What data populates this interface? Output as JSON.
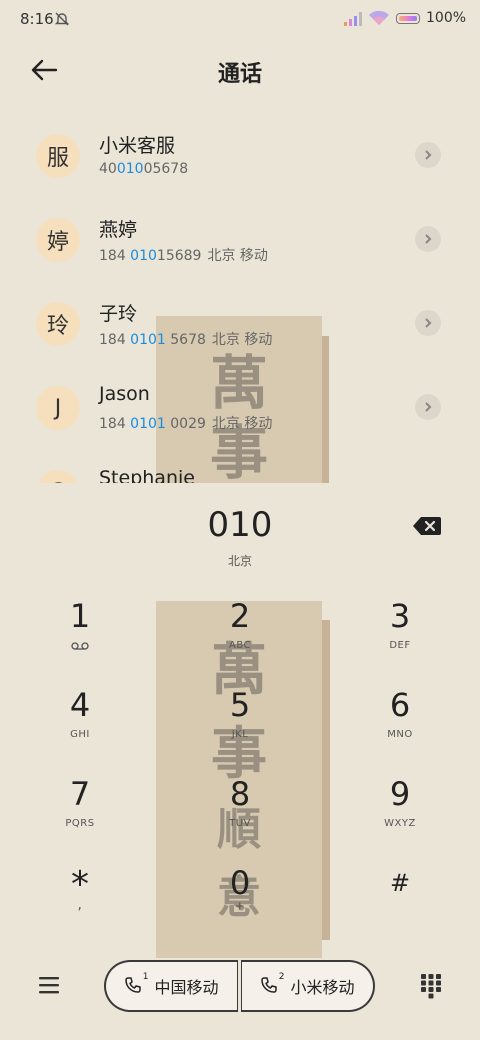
{
  "status": {
    "time": "8:16",
    "battery": "100%"
  },
  "header": {
    "title": "通话"
  },
  "contacts": [
    {
      "avatar": "服",
      "name": "小米客服",
      "num_pre": "40",
      "num_hl": "010",
      "num_post": "05678",
      "location": ""
    },
    {
      "avatar": "婷",
      "name": "燕婷",
      "num_pre": "184 ",
      "num_hl": "010",
      "num_post": "15689",
      "location": "北京 移动"
    },
    {
      "avatar": "玲",
      "name": "子玲",
      "num_pre": "184 ",
      "num_hl": "0101",
      "num_post": " 5678",
      "location": "北京 移动"
    },
    {
      "avatar": "J",
      "name": "Jason",
      "num_pre": "184 ",
      "num_hl": "0101",
      "num_post": " 0029",
      "location": "北京 移动"
    },
    {
      "avatar": "S",
      "name": "Stephanie",
      "num_pre": "",
      "num_hl": "",
      "num_post": "",
      "location": ""
    }
  ],
  "dial": {
    "number": "010",
    "location": "北京"
  },
  "keys": [
    {
      "digit": "1",
      "letters": ""
    },
    {
      "digit": "2",
      "letters": "ABC"
    },
    {
      "digit": "3",
      "letters": "DEF"
    },
    {
      "digit": "4",
      "letters": "GHI"
    },
    {
      "digit": "5",
      "letters": "JKL"
    },
    {
      "digit": "6",
      "letters": "MNO"
    },
    {
      "digit": "7",
      "letters": "PQRS"
    },
    {
      "digit": "8",
      "letters": "TUV"
    },
    {
      "digit": "9",
      "letters": "WXYZ"
    },
    {
      "digit": "*",
      "letters": ","
    },
    {
      "digit": "0",
      "letters": "+"
    },
    {
      "digit": "#",
      "letters": ""
    }
  ],
  "sims": [
    {
      "slot": "1",
      "label": "中国移动"
    },
    {
      "slot": "2",
      "label": "小米移动"
    }
  ],
  "wallpaper": {
    "glyphs_top": [
      "萬",
      "事"
    ],
    "glyphs_bottom": [
      "萬",
      "事",
      "順",
      "意"
    ]
  }
}
